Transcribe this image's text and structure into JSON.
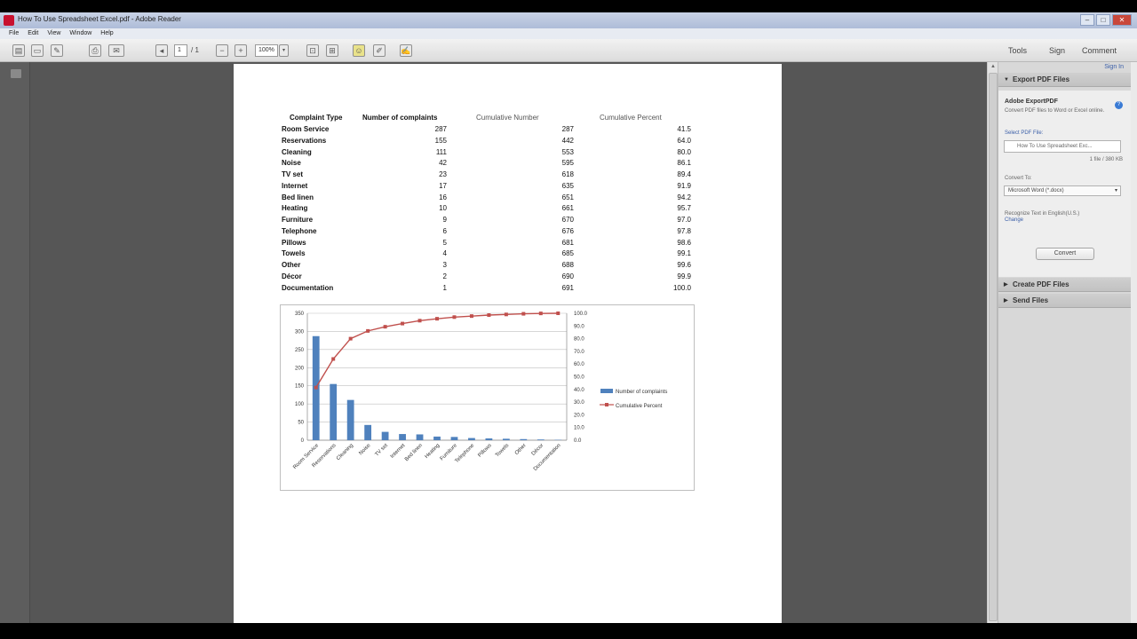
{
  "window": {
    "title": "How To Use Spreadsheet Excel.pdf - Adobe Reader",
    "minimize": "–",
    "maximize": "□",
    "close": "✕"
  },
  "menu": [
    "File",
    "Edit",
    "View",
    "Window",
    "Help"
  ],
  "toolbar": {
    "page_current": "1",
    "page_total": "/ 1",
    "zoom": "100%",
    "tools": "Tools",
    "sign": "Sign",
    "comment": "Comment"
  },
  "right_panel": {
    "sign_in": "Sign In",
    "export_header": "Export PDF Files",
    "export_title": "Adobe ExportPDF",
    "export_desc": "Convert PDF files to Word or Excel online.",
    "select_file_label": "Select PDF File:",
    "selected_file": "How To Use Spreadsheet Exc...",
    "file_count": "1 file / 380 KB",
    "convert_to_label": "Convert To:",
    "convert_to_value": "Microsoft Word (*.docx)",
    "recognize_text": "Recognize Text in English(U.S.)",
    "change_link": "Change",
    "convert_button": "Convert",
    "create_header": "Create PDF Files",
    "send_header": "Send Files"
  },
  "document": {
    "headers": [
      "Complaint Type",
      "Number of complaints",
      "Cumulative Number",
      "Cumulative Percent"
    ],
    "rows": [
      {
        "type": "Room Service",
        "count": "287",
        "cum": "287",
        "pct": "41.5"
      },
      {
        "type": "Reservations",
        "count": "155",
        "cum": "442",
        "pct": "64.0"
      },
      {
        "type": "Cleaning",
        "count": "111",
        "cum": "553",
        "pct": "80.0"
      },
      {
        "type": "Noise",
        "count": "42",
        "cum": "595",
        "pct": "86.1"
      },
      {
        "type": "TV set",
        "count": "23",
        "cum": "618",
        "pct": "89.4"
      },
      {
        "type": "Internet",
        "count": "17",
        "cum": "635",
        "pct": "91.9"
      },
      {
        "type": "Bed linen",
        "count": "16",
        "cum": "651",
        "pct": "94.2"
      },
      {
        "type": "Heating",
        "count": "10",
        "cum": "661",
        "pct": "95.7"
      },
      {
        "type": "Furniture",
        "count": "9",
        "cum": "670",
        "pct": "97.0"
      },
      {
        "type": "Telephone",
        "count": "6",
        "cum": "676",
        "pct": "97.8"
      },
      {
        "type": "Pillows",
        "count": "5",
        "cum": "681",
        "pct": "98.6"
      },
      {
        "type": "Towels",
        "count": "4",
        "cum": "685",
        "pct": "99.1"
      },
      {
        "type": "Other",
        "count": "3",
        "cum": "688",
        "pct": "99.6"
      },
      {
        "type": "Décor",
        "count": "2",
        "cum": "690",
        "pct": "99.9"
      },
      {
        "type": "Documentation",
        "count": "1",
        "cum": "691",
        "pct": "100.0"
      }
    ]
  },
  "chart_data": {
    "type": "bar",
    "categories": [
      "Room Service",
      "Reservations",
      "Cleaning",
      "Noise",
      "TV set",
      "Internet",
      "Bed linen",
      "Heating",
      "Furniture",
      "Telephone",
      "Pillows",
      "Towels",
      "Other",
      "Décor",
      "Documentation"
    ],
    "series": [
      {
        "name": "Number of complaints",
        "type": "bar",
        "axis": "left",
        "color": "#4f81bd",
        "values": [
          287,
          155,
          111,
          42,
          23,
          17,
          16,
          10,
          9,
          6,
          5,
          4,
          3,
          2,
          1
        ]
      },
      {
        "name": "Cumulative Percent",
        "type": "line",
        "axis": "right",
        "color": "#c0504d",
        "values": [
          41.5,
          64.0,
          80.0,
          86.1,
          89.4,
          91.9,
          94.2,
          95.7,
          97.0,
          97.8,
          98.6,
          99.1,
          99.6,
          99.9,
          100.0
        ]
      }
    ],
    "ylim_left": [
      0,
      350
    ],
    "yticks_left": [
      "0",
      "50",
      "100",
      "150",
      "200",
      "250",
      "300",
      "350"
    ],
    "ylim_right": [
      0,
      100
    ],
    "yticks_right": [
      "0.0",
      "10.0",
      "20.0",
      "30.0",
      "40.0",
      "50.0",
      "60.0",
      "70.0",
      "80.0",
      "90.0",
      "100.0"
    ],
    "legend_position": "right",
    "grid": true
  }
}
